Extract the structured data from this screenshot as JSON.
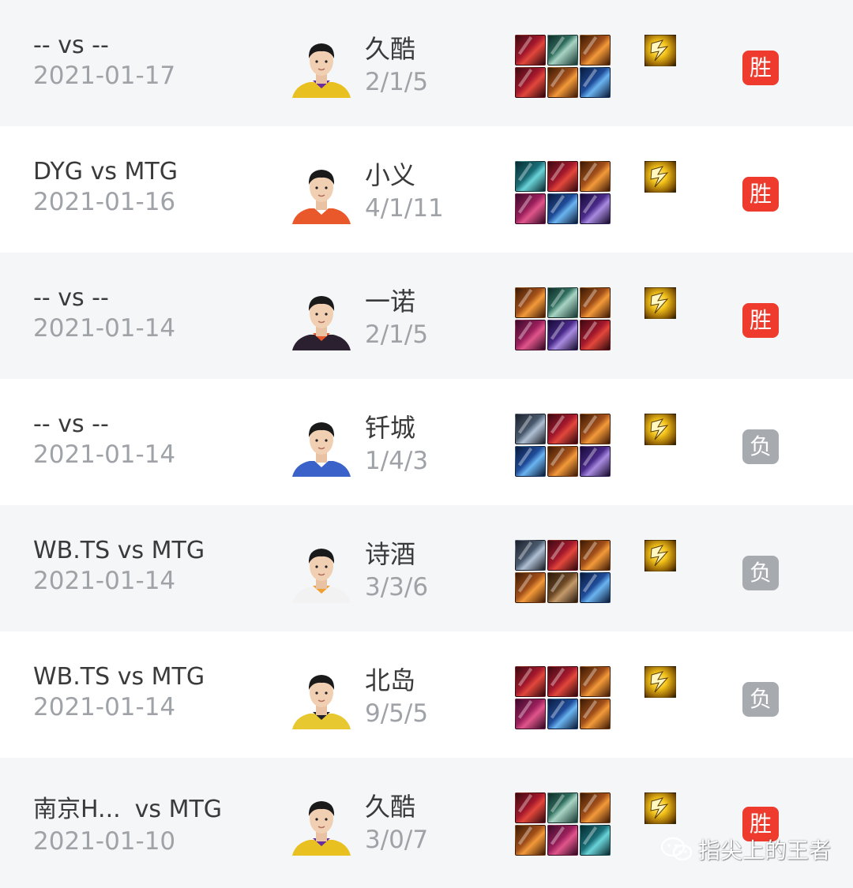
{
  "matches": [
    {
      "team_a": "--",
      "vs": "vs",
      "team_b": "--",
      "date": "2021-01-17",
      "player": "久酷",
      "kda": "2/1/5",
      "avatar_jersey": "#e8c020",
      "avatar_collar": "#6a2aa0",
      "items": [
        "t-red",
        "t-green",
        "t-orange",
        "t-red",
        "t-orange",
        "t-blue"
      ],
      "result": "胜",
      "result_type": "win"
    },
    {
      "team_a": "DYG",
      "vs": "vs",
      "team_b": "MTG",
      "date": "2021-01-16",
      "player": "小义",
      "kda": "4/1/11",
      "avatar_jersey": "#e8582a",
      "avatar_collar": "#ffffff",
      "items": [
        "t-teal",
        "t-red",
        "t-orange",
        "t-magenta",
        "t-blue",
        "t-purple"
      ],
      "result": "胜",
      "result_type": "win"
    },
    {
      "team_a": "--",
      "vs": "vs",
      "team_b": "--",
      "date": "2021-01-14",
      "player": "一诺",
      "kda": "2/1/5",
      "avatar_jersey": "#2a2030",
      "avatar_collar": "#e8582a",
      "items": [
        "t-orange",
        "t-green",
        "t-orange",
        "t-magenta",
        "t-purple",
        "t-red"
      ],
      "result": "胜",
      "result_type": "win"
    },
    {
      "team_a": "--",
      "vs": "vs",
      "team_b": "--",
      "date": "2021-01-14",
      "player": "钎城",
      "kda": "1/4/3",
      "avatar_jersey": "#3a62c8",
      "avatar_collar": "#ffffff",
      "items": [
        "t-steel",
        "t-red",
        "t-orange",
        "t-blue",
        "t-orange",
        "t-purple"
      ],
      "result": "负",
      "result_type": "loss"
    },
    {
      "team_a": "WB.TS",
      "vs": "vs",
      "team_b": "MTG",
      "date": "2021-01-14",
      "player": "诗酒",
      "kda": "3/3/6",
      "avatar_jersey": "#f2f2f2",
      "avatar_collar": "#f0a030",
      "items": [
        "t-steel",
        "t-red",
        "t-orange",
        "t-orange",
        "t-brown",
        "t-blue"
      ],
      "result": "负",
      "result_type": "loss"
    },
    {
      "team_a": "WB.TS",
      "vs": "vs",
      "team_b": "MTG",
      "date": "2021-01-14",
      "player": "北岛",
      "kda": "9/5/5",
      "avatar_jersey": "#e8c830",
      "avatar_collar": "#202030",
      "items": [
        "t-red",
        "t-red",
        "t-orange",
        "t-magenta",
        "t-blue",
        "t-orange"
      ],
      "result": "负",
      "result_type": "loss"
    },
    {
      "team_a": "南京H...",
      "vs": "vs",
      "team_b": "MTG",
      "date": "2021-01-10",
      "player": "久酷",
      "kda": "3/0/7",
      "avatar_jersey": "#e8c020",
      "avatar_collar": "#6a2aa0",
      "items": [
        "t-red",
        "t-green",
        "t-orange",
        "t-orange",
        "t-magenta",
        "t-teal"
      ],
      "result": "胜",
      "result_type": "win"
    }
  ],
  "watermark": {
    "text": "指尖上的王者"
  },
  "icons": {
    "spell": "flash-spell-icon",
    "watermark": "wechat-icon"
  },
  "colors": {
    "win": "#ef3b2e",
    "loss": "#a7aaae",
    "row_alt": "#f4f6f8"
  }
}
